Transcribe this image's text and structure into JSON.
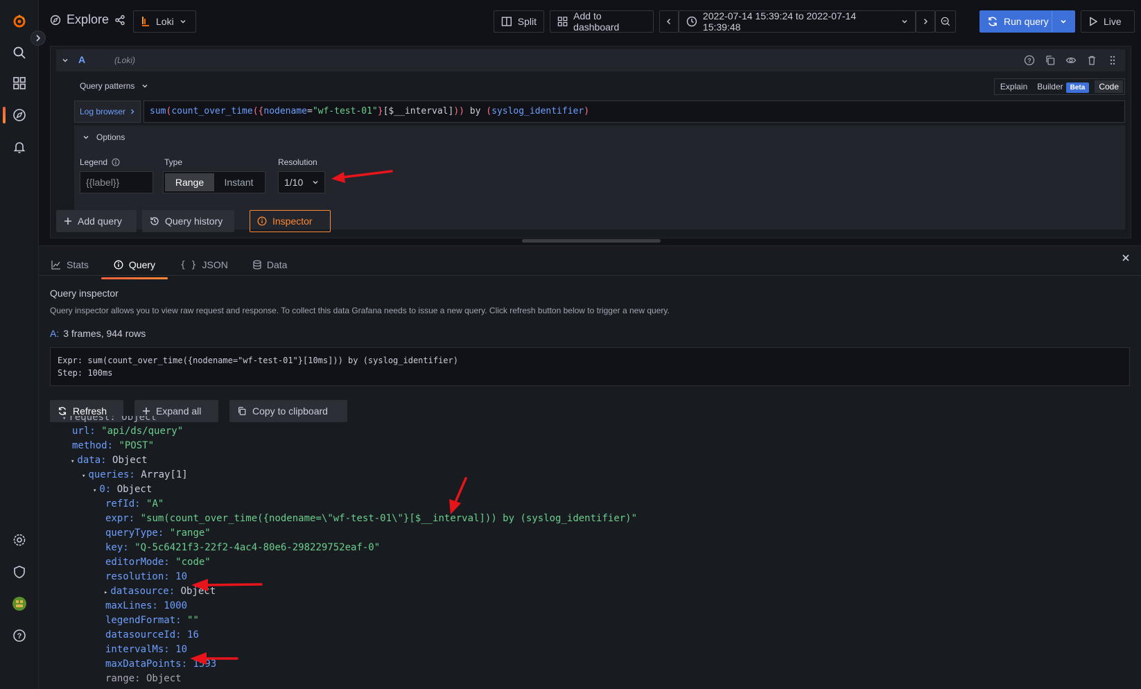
{
  "topbar": {
    "title": "Explore",
    "datasource": "Loki",
    "split": "Split",
    "add_to_dashboard": "Add to dashboard",
    "time_range": "2022-07-14 15:39:24 to 2022-07-14 15:39:48",
    "run_query": "Run query",
    "live": "Live"
  },
  "query": {
    "ref_id": "A",
    "datasource_name": "(Loki)",
    "patterns": "Query patterns",
    "modes": [
      "Explain",
      "Builder",
      "Code"
    ],
    "beta": "Beta",
    "log_browser": "Log browser",
    "expr_parts": [
      "sum",
      "(",
      "count_over_time",
      "(",
      "{",
      "nodename",
      "=",
      "\"wf-test-01\"",
      "}",
      "[$__interval]",
      ")",
      ")",
      " by ",
      "(",
      "syslog_identifier",
      ")"
    ],
    "options": {
      "title": "Options",
      "legend_label": "Legend",
      "legend_placeholder": "{{label}}",
      "type_label": "Type",
      "type_options": [
        "Range",
        "Instant"
      ],
      "resolution_label": "Resolution",
      "resolution_value": "1/10"
    },
    "actions": {
      "add_query": "Add query",
      "history": "Query history",
      "inspector": "Inspector"
    }
  },
  "inspector": {
    "tabs": [
      "Stats",
      "Query",
      "JSON",
      "Data"
    ],
    "title": "Query inspector",
    "description": "Query inspector allows you to view raw request and response. To collect this data Grafana needs to issue a new query. Click refresh button below to trigger a new query.",
    "frames_ref": "A:",
    "frames_text": "3 frames, 944 rows",
    "expr_line": "Expr: sum(count_over_time({nodename=\"wf-test-01\"}[10ms])) by (syslog_identifier)",
    "step_line": "Step: 100ms",
    "refresh": "Refresh",
    "expand_all": "Expand all",
    "copy": "Copy to clipboard"
  },
  "json_tree": {
    "top_partial": "request: Object",
    "url_key": "url:",
    "url_val": "\"api/ds/query\"",
    "method_key": "method:",
    "method_val": "\"POST\"",
    "data_key": "data:",
    "data_val": "Object",
    "queries_key": "queries:",
    "queries_val": "Array[1]",
    "zero_key": "0:",
    "zero_val": "Object",
    "refId_key": "refId:",
    "refId_val": "\"A\"",
    "expr_key": "expr:",
    "expr_val": "\"sum(count_over_time({nodename=\\\"wf-test-01\\\"}[$__interval])) by (syslog_identifier)\"",
    "queryType_key": "queryType:",
    "queryType_val": "\"range\"",
    "key_key": "key:",
    "key_val": "\"Q-5c6421f3-22f2-4ac4-80e6-298229752eaf-0\"",
    "editorMode_key": "editorMode:",
    "editorMode_val": "\"code\"",
    "resolution_key": "resolution:",
    "resolution_val": "10",
    "datasource_key": "datasource:",
    "datasource_val": "Object",
    "maxLines_key": "maxLines:",
    "maxLines_val": "1000",
    "legendFormat_key": "legendFormat:",
    "legendFormat_val": "\"\"",
    "datasourceId_key": "datasourceId:",
    "datasourceId_val": "16",
    "intervalMs_key": "intervalMs:",
    "intervalMs_val": "10",
    "maxDataPoints_key": "maxDataPoints:",
    "maxDataPoints_val": "1593",
    "bottom_partial": "range: Object"
  },
  "colors": {
    "accent": "#3d71d9",
    "inspector": "#ff8833",
    "arrow": "#e8141c",
    "string": "#6ccf8e",
    "key": "#6e9fff"
  }
}
